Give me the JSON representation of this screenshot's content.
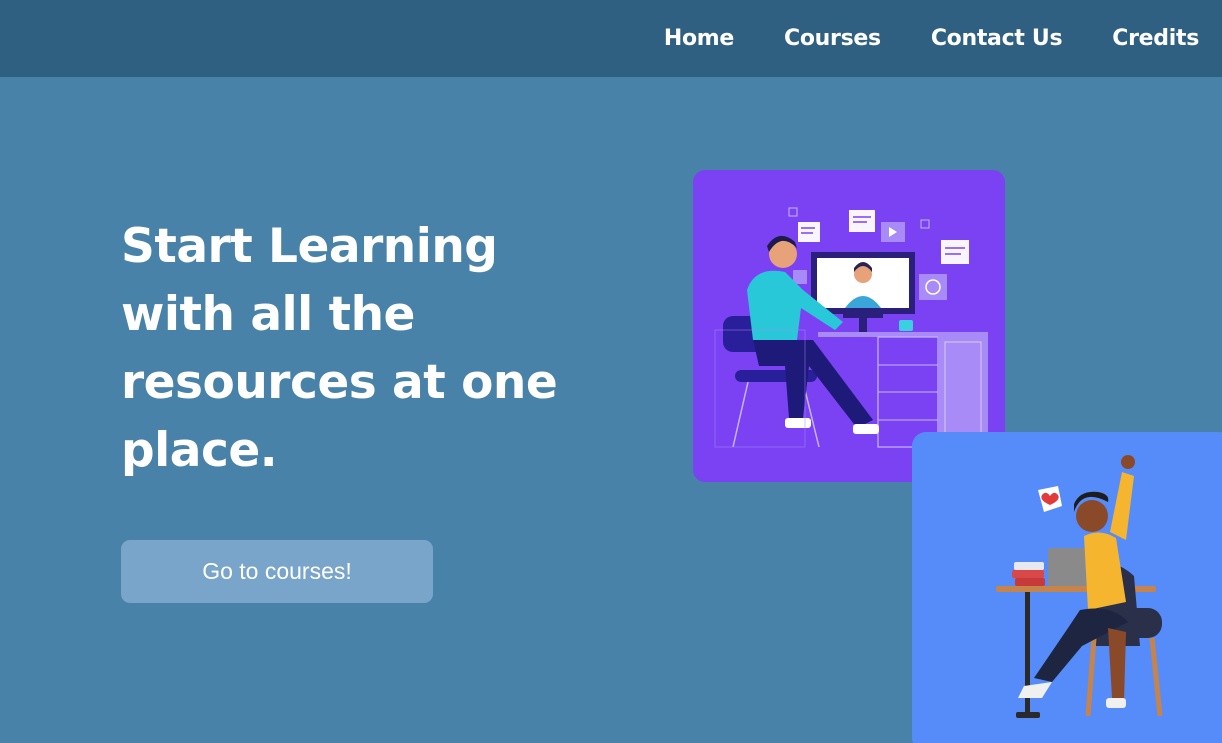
{
  "nav": {
    "items": [
      {
        "label": "Home"
      },
      {
        "label": "Courses"
      },
      {
        "label": "Contact Us"
      },
      {
        "label": "Credits"
      }
    ]
  },
  "hero": {
    "title_lines": [
      "Start Learning",
      "with all the",
      "resources at one",
      "place."
    ],
    "cta_label": "Go to courses!"
  },
  "colors": {
    "page_bg": "#4882a8",
    "navbar_bg": "#2f5f81",
    "cta_bg": "#7aa5ca",
    "card_purple": "#7b42f4",
    "card_blue": "#568cf9"
  },
  "illustrations": [
    {
      "name": "online-learning-illustration"
    },
    {
      "name": "student-celebrating-illustration"
    }
  ]
}
